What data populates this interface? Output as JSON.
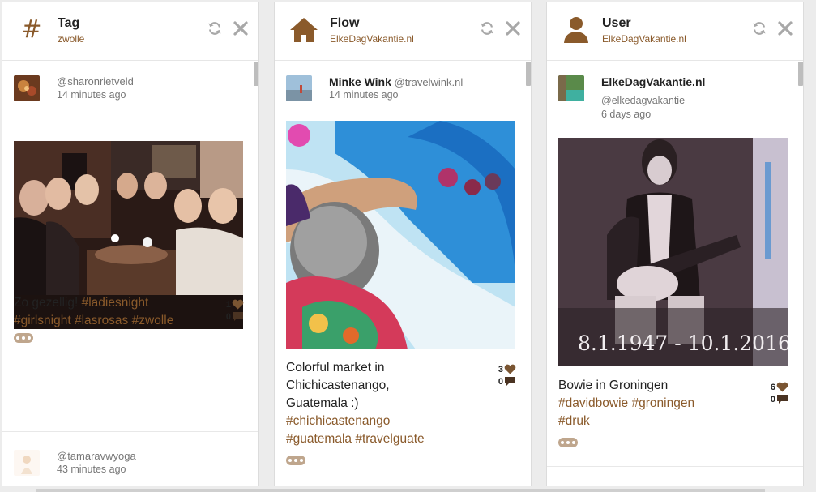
{
  "columns": [
    {
      "title": "Tag",
      "subtitle": "zwolle",
      "icon": "hash-icon",
      "posts": [
        {
          "handle": "@sharonrietveld",
          "time": "14 minutes ago",
          "caption_text": "Zo gezellig! ",
          "caption_tags": [
            "#ladiesnight",
            "#girlsnight",
            "#lasrosas",
            "#zwolle"
          ],
          "likes": "1",
          "comments": "0"
        },
        {
          "handle": "@tamaravwyoga",
          "time": "43 minutes ago"
        }
      ]
    },
    {
      "title": "Flow",
      "subtitle": "ElkeDagVakantie.nl",
      "icon": "home-icon",
      "posts": [
        {
          "name": "Minke Wink",
          "handle": "@travelwink.nl",
          "time": "14 minutes ago",
          "caption_text": "Colorful market in Chichicastenango, Guatemala :)",
          "caption_tags": [
            "#chichicastenango",
            "#guatemala",
            "#travelguate"
          ],
          "likes": "3",
          "comments": "0"
        }
      ]
    },
    {
      "title": "User",
      "subtitle": "ElkeDagVakantie.nl",
      "icon": "user-icon",
      "posts": [
        {
          "name": "ElkeDagVakantie.nl",
          "handle": "@elkedagvakantie",
          "time": "6 days ago",
          "caption_text": "Bowie in Groningen",
          "caption_tags": [
            "#davidbowie",
            "#groningen",
            "#druk"
          ],
          "likes": "6",
          "comments": "0",
          "photo_text": "8.1.1947 - 10.1.2016"
        }
      ]
    }
  ],
  "colors": {
    "accent": "#8a5a2b",
    "icon_gray": "#a8a8a8",
    "more_button": "#bfa68d"
  }
}
